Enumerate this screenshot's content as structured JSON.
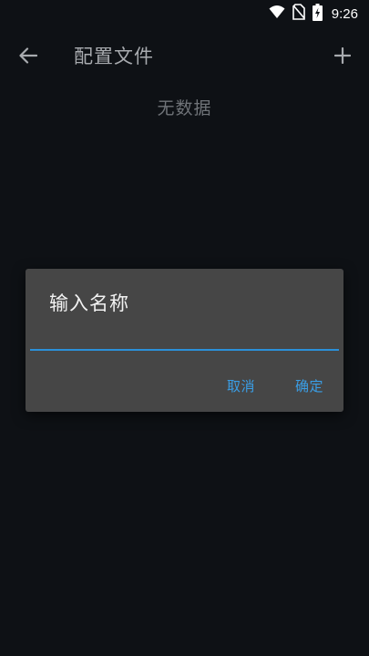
{
  "status_bar": {
    "time": "9:26",
    "icons": [
      "wifi-icon",
      "no-sim-icon",
      "battery-icon"
    ]
  },
  "app_bar": {
    "back_icon": "arrow-left-icon",
    "title": "配置文件",
    "add_icon": "plus-icon"
  },
  "content": {
    "empty_text": "无数据"
  },
  "dialog": {
    "title": "输入名称",
    "input_value": "",
    "input_placeholder": "",
    "cancel_label": "取消",
    "confirm_label": "确定"
  },
  "colors": {
    "background": "#0e1115",
    "dialog_bg": "#464646",
    "accent": "#3a9ee6",
    "title_text": "#a8abaf",
    "empty_text": "#6f7378"
  }
}
